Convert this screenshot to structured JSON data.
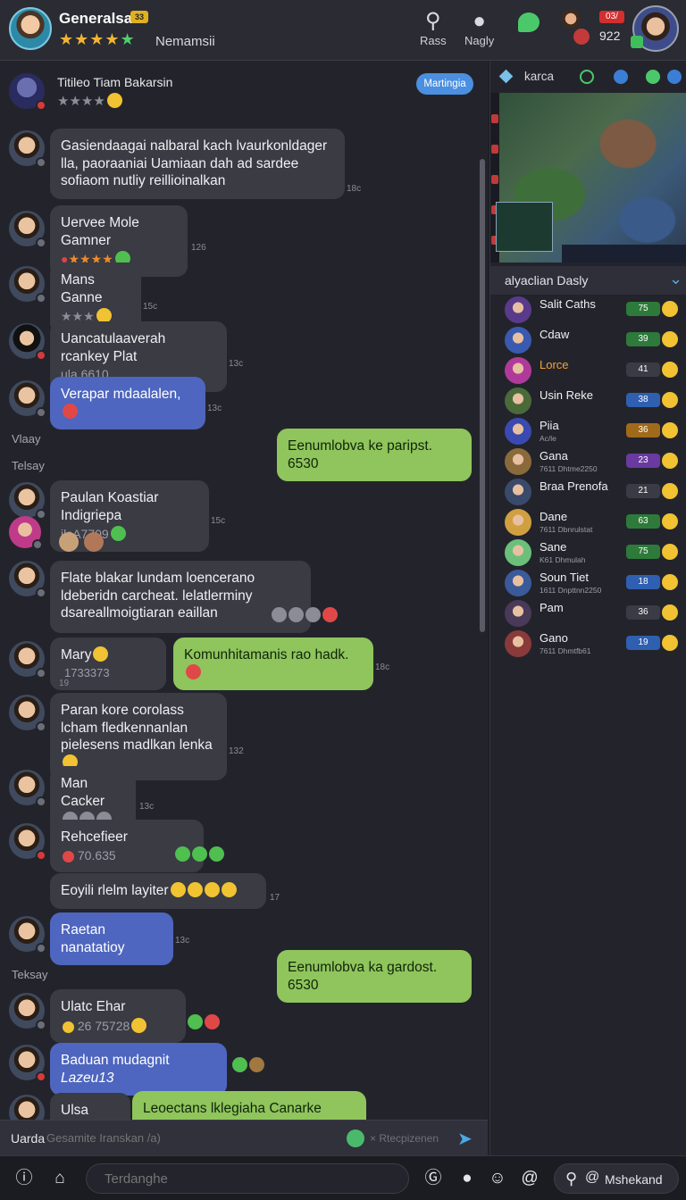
{
  "header": {
    "name": "Generalsa",
    "badge": "33",
    "stars": "★★★★",
    "star_green": "★",
    "subtitle": "Nemamsii",
    "rass_label": "Rass",
    "nagly_label": "Nagly",
    "pill_label": "03/",
    "count": "922"
  },
  "chat": {
    "pill": "Martingia",
    "day1": "Vlaay",
    "day2": "Telsay",
    "day3": "Teksay",
    "messages": [
      {
        "title": "Titileo Tiam Bakarsin",
        "stars": "★★★★"
      },
      {
        "text": "Gasiendaagai nalbaral kach lvaurkonldager lla, paoraaniai Uamiaan dah ad sardee sofiaom nutliy reillioinalkan",
        "ts": "18c"
      },
      {
        "title": "Uervee Mole Gamner",
        "stars": "★★★★",
        "ts": "126"
      },
      {
        "title": "Mans Ganne",
        "stars": "★★★",
        "ts": "15c"
      },
      {
        "title": "Uancatulaaverah rcankey Plat",
        "sub": "ula 6610",
        "ts": "13c"
      },
      {
        "text": "Verapar mdaalalen,",
        "ts": "13c"
      },
      {
        "text": "Eenumlobva ke paripst.  6530"
      },
      {
        "title": "Paulan Koastiar Indigriepa",
        "sub": "ilsA7709",
        "ts": "15c"
      },
      {
        "text": "Flate blakar lundam loencerano ldeberidn carcheat. lelatlerminy dsareallmoigtiaran eaillan"
      },
      {
        "text": "Mary",
        "sub": "1733373"
      },
      {
        "text": "Komunhitamanis rao hadk.",
        "ts": "18c"
      },
      {
        "ts": "19"
      },
      {
        "text": "Paran kore corolass lcham fledkennanlan pielesens madlkan lenka",
        "ts": "132"
      },
      {
        "title": "Man Cacker"
      },
      {
        "title": "Rehcefieer",
        "sub": "70.635"
      },
      {
        "text": "Eoyili rlelm layiter",
        "ts": "17"
      },
      {
        "text": "Raetan nanatatioy",
        "ts": "13c"
      },
      {
        "text": "Eenumlobva ka gardost.  6530"
      },
      {
        "title": "Ulatc Ehar",
        "sub": "26 75728"
      },
      {
        "text": "Baduan mudagnit",
        "sub": "Lazeu13"
      },
      {
        "title": "Ulsa Gawee"
      },
      {
        "text": "Leoectans lklegiaha Canarke Minse Llehsir"
      }
    ]
  },
  "composer": {
    "label": "Uarda",
    "placeholder": "Gesamite Iranskan /a)",
    "extra": "× Rtecpizenen"
  },
  "right": {
    "tab_label": "karca",
    "list_title": "alyaclian Dasly",
    "players": [
      {
        "name": "Salit Caths",
        "stat": "75",
        "color": "#2d7a3a"
      },
      {
        "name": "Cdaw",
        "stat": "39",
        "color": "#2d7a3a"
      },
      {
        "name": "Lorce",
        "stat": "41",
        "color": "#3a3b44",
        "orange": true
      },
      {
        "name": "Usin Reke",
        "stat": "38",
        "color": "#2f5fb0"
      },
      {
        "name": "Piia",
        "detail": "Ac/le",
        "stat": "36",
        "color": "#a06a1a"
      },
      {
        "name": "Gana",
        "detail": "7611 Dhtme2250",
        "stat": "23",
        "color": "#6a3aa0"
      },
      {
        "name": "Braa Prenofa",
        "stat": "21",
        "color": "#3a3b44"
      },
      {
        "name": "Dane",
        "detail": "7611 Dbnrulstat",
        "stat": "63",
        "color": "#2d7a3a"
      },
      {
        "name": "Sane",
        "detail": "K61 Dhmulah",
        "stat": "75",
        "color": "#2d7a3a"
      },
      {
        "name": "Soun Tiet",
        "detail": "1611 Dnpttnn2250",
        "stat": "18",
        "color": "#2f5fb0"
      },
      {
        "name": "Pam",
        "stat": "36",
        "color": "#3a3b44"
      },
      {
        "name": "Gano",
        "detail": "7611 Dhmtfb61",
        "stat": "19",
        "color": "#2f5fb0"
      }
    ]
  },
  "bottom": {
    "input_placeholder": "Terdanghe",
    "search_label": "Mshekand"
  }
}
